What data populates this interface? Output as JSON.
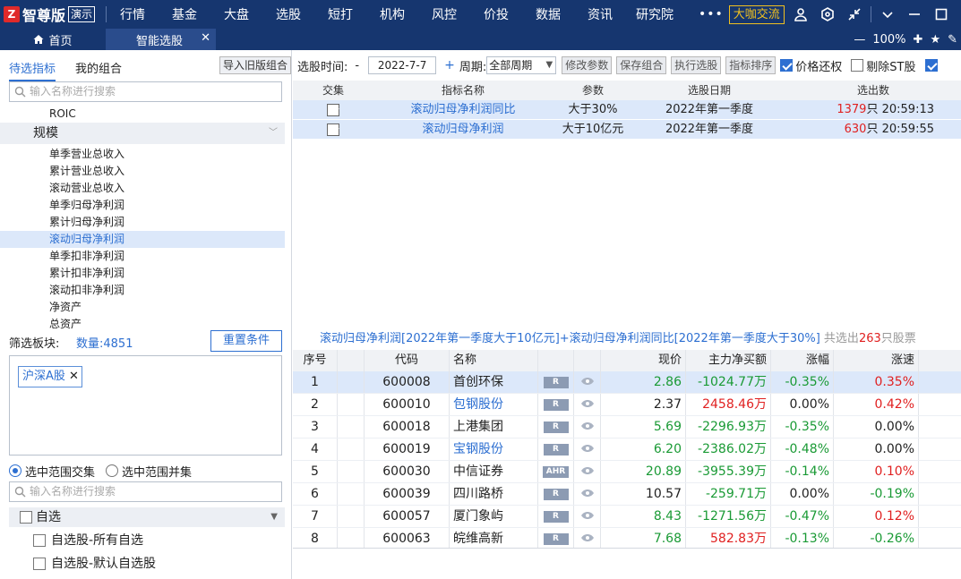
{
  "header": {
    "logo_mark": "Z",
    "logo_text": "智尊版",
    "demo_badge": "演示",
    "menu": [
      "行情",
      "基金",
      "大盘",
      "选股",
      "短打",
      "机构",
      "风控",
      "价投",
      "数据",
      "资讯",
      "研究院"
    ],
    "more": "•••",
    "coffee_button": "大咖交流"
  },
  "tabs": {
    "home": "首页",
    "active": "智能选股",
    "zoom": "100%"
  },
  "left_panel": {
    "tab_active": "待选指标",
    "tab_other": "我的组合",
    "import_button": "导入旧版组合",
    "search_placeholder": "输入名称进行搜索",
    "tree": {
      "top_item": "ROIC",
      "category": "规模",
      "items": [
        "单季营业总收入",
        "累计营业总收入",
        "滚动营业总收入",
        "单季归母净利润",
        "累计归母净利润",
        "滚动归母净利润",
        "单季扣非净利润",
        "累计扣非净利润",
        "滚动扣非净利润",
        "净资产",
        "总资产"
      ],
      "selected_index": 5
    },
    "filter_label": "筛选板块:",
    "count": "数量:4851",
    "reset_button": "重置条件",
    "chip": "沪深A股",
    "radio_intersect": "选中范围交集",
    "radio_union": "选中范围并集",
    "search2_placeholder": "输入名称进行搜索",
    "group_head": "自选",
    "group_items": [
      "自选股-所有自选",
      "自选股-默认自选股"
    ]
  },
  "toolbar": {
    "time_label": "选股时间:",
    "dash": "-",
    "date": "2022-7-7",
    "plus": "+",
    "period_label": "周期:",
    "period_value": "全部周期",
    "buttons": [
      "修改参数",
      "保存组合",
      "执行选股",
      "指标排序"
    ],
    "checks": [
      {
        "label": "价格还权",
        "checked": true
      },
      {
        "label": "剔除ST股",
        "checked": false
      },
      {
        "label": "",
        "checked": true
      }
    ]
  },
  "conditions": {
    "headers": [
      "交集",
      "指标名称",
      "参数",
      "选股日期",
      "选出数"
    ],
    "rows": [
      {
        "name": "滚动归母净利润同比",
        "param": "大于30%",
        "date": "2022年第一季度",
        "count": "1379",
        "unit": "只",
        "time": "20:59:13"
      },
      {
        "name": "滚动归母净利润",
        "param": "大于10亿元",
        "date": "2022年第一季度",
        "count": "630",
        "unit": "只",
        "time": "20:59:55"
      }
    ]
  },
  "summary": {
    "text": "滚动归母净利润[2022年第一季度大于10亿元]+滚动归母净利润同比[2022年第一季度大于30%]",
    "prefix": " 共选出",
    "count": "263",
    "suffix": "只股票"
  },
  "results": {
    "headers": [
      "序号",
      "代码",
      "名称",
      "现价",
      "主力净买额",
      "涨幅",
      "涨速"
    ],
    "rows": [
      {
        "no": "1",
        "code": "600008",
        "name": "首创环保",
        "tag": "R",
        "price": "2.86",
        "net": "-1024.77万",
        "chg": "-0.35%",
        "speed": "0.35%",
        "name_blue": false,
        "price_c": "grn",
        "net_c": "grn",
        "chg_c": "grn",
        "speed_c": "red"
      },
      {
        "no": "2",
        "code": "600010",
        "name": "包钢股份",
        "tag": "R",
        "price": "2.37",
        "net": "2458.46万",
        "chg": "0.00%",
        "speed": "0.42%",
        "name_blue": true,
        "price_c": "",
        "net_c": "red",
        "chg_c": "",
        "speed_c": "red"
      },
      {
        "no": "3",
        "code": "600018",
        "name": "上港集团",
        "tag": "R",
        "price": "5.69",
        "net": "-2296.93万",
        "chg": "-0.35%",
        "speed": "0.00%",
        "name_blue": false,
        "price_c": "grn",
        "net_c": "grn",
        "chg_c": "grn",
        "speed_c": ""
      },
      {
        "no": "4",
        "code": "600019",
        "name": "宝钢股份",
        "tag": "R",
        "price": "6.20",
        "net": "-2386.02万",
        "chg": "-0.48%",
        "speed": "0.00%",
        "name_blue": true,
        "price_c": "grn",
        "net_c": "grn",
        "chg_c": "grn",
        "speed_c": ""
      },
      {
        "no": "5",
        "code": "600030",
        "name": "中信证券",
        "tag": "AHR",
        "price": "20.89",
        "net": "-3955.39万",
        "chg": "-0.14%",
        "speed": "0.10%",
        "name_blue": false,
        "price_c": "grn",
        "net_c": "grn",
        "chg_c": "grn",
        "speed_c": "red"
      },
      {
        "no": "6",
        "code": "600039",
        "name": "四川路桥",
        "tag": "R",
        "price": "10.57",
        "net": "-259.71万",
        "chg": "0.00%",
        "speed": "-0.19%",
        "name_blue": false,
        "price_c": "",
        "net_c": "grn",
        "chg_c": "",
        "speed_c": "grn"
      },
      {
        "no": "7",
        "code": "600057",
        "name": "厦门象屿",
        "tag": "R",
        "price": "8.43",
        "net": "-1271.56万",
        "chg": "-0.47%",
        "speed": "0.12%",
        "name_blue": false,
        "price_c": "grn",
        "net_c": "grn",
        "chg_c": "grn",
        "speed_c": "red"
      },
      {
        "no": "8",
        "code": "600063",
        "name": "皖维高新",
        "tag": "R",
        "price": "7.68",
        "net": "582.83万",
        "chg": "-0.13%",
        "speed": "-0.26%",
        "name_blue": false,
        "price_c": "grn",
        "net_c": "red",
        "chg_c": "grn",
        "speed_c": "grn"
      }
    ]
  },
  "colors": {
    "brand": "#16366f",
    "accent": "#2d6fd1",
    "up": "#e02020",
    "down": "#1a9a35"
  }
}
